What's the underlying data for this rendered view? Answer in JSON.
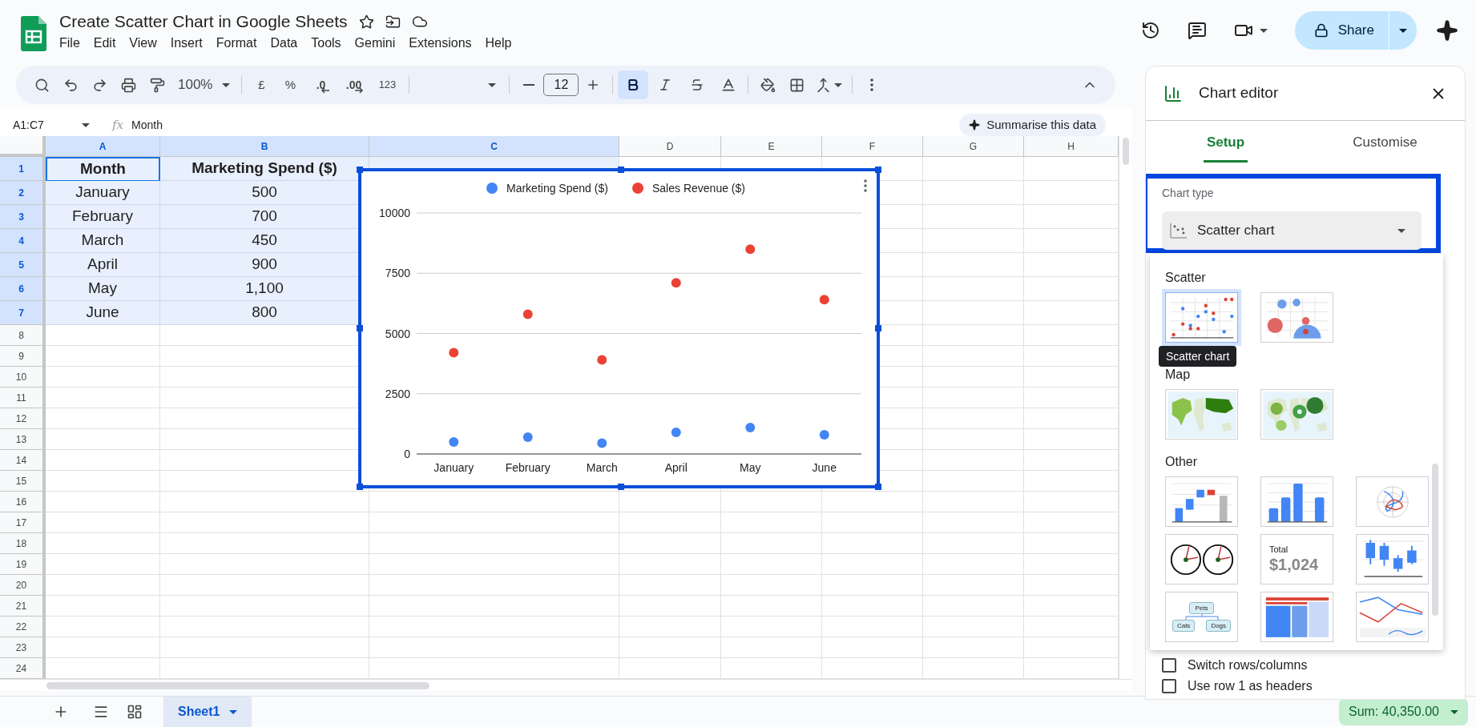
{
  "document": {
    "title": "Create Scatter Chart in Google Sheets"
  },
  "menu": [
    "File",
    "Edit",
    "View",
    "Insert",
    "Format",
    "Data",
    "Tools",
    "Gemini",
    "Extensions",
    "Help"
  ],
  "share": {
    "label": "Share"
  },
  "toolbar": {
    "zoom": "100%",
    "currency": "£",
    "percent": "%",
    "decrease_decimal": ".0",
    "increase_decimal": ".00",
    "number_format": "123",
    "font_size": "12",
    "format_buttons": [
      {
        "kind": "bold",
        "selected": true
      },
      {
        "kind": "italic",
        "selected": false
      },
      {
        "kind": "strikethrough",
        "selected": false
      }
    ]
  },
  "formula_bar": {
    "name_box": "A1:C7",
    "fx": "fx",
    "formula": "Month",
    "summarise": "Summarise this data"
  },
  "sheet": {
    "columns": [
      {
        "label": "A",
        "selected": true
      },
      {
        "label": "B",
        "selected": true
      },
      {
        "label": "C",
        "selected": true
      },
      {
        "label": "D",
        "selected": false
      },
      {
        "label": "E",
        "selected": false
      },
      {
        "label": "F",
        "selected": false
      },
      {
        "label": "G",
        "selected": false
      },
      {
        "label": "H",
        "selected": false
      }
    ],
    "rows": [
      {
        "number": "1",
        "selected": true,
        "kind": "header",
        "cells": [
          {
            "text": "Month",
            "active": true
          },
          {
            "text": "Marketing Spend ($)",
            "active": false
          }
        ]
      },
      {
        "number": "2",
        "selected": true,
        "kind": "data",
        "cells": [
          {
            "text": "January",
            "active": false
          },
          {
            "text": "500",
            "active": false
          }
        ]
      },
      {
        "number": "3",
        "selected": true,
        "kind": "data",
        "cells": [
          {
            "text": "February",
            "active": false
          },
          {
            "text": "700",
            "active": false
          }
        ]
      },
      {
        "number": "4",
        "selected": true,
        "kind": "data",
        "cells": [
          {
            "text": "March",
            "active": false
          },
          {
            "text": "450",
            "active": false
          }
        ]
      },
      {
        "number": "5",
        "selected": true,
        "kind": "data",
        "cells": [
          {
            "text": "April",
            "active": false
          },
          {
            "text": "900",
            "active": false
          }
        ]
      },
      {
        "number": "6",
        "selected": true,
        "kind": "data",
        "cells": [
          {
            "text": "May",
            "active": false
          },
          {
            "text": "1,100",
            "active": false
          }
        ]
      },
      {
        "number": "7",
        "selected": true,
        "kind": "data",
        "cells": [
          {
            "text": "June",
            "active": false
          },
          {
            "text": "800",
            "active": false
          }
        ]
      },
      {
        "number": "8",
        "selected": false
      },
      {
        "number": "9",
        "selected": false
      },
      {
        "number": "10",
        "selected": false
      },
      {
        "number": "11",
        "selected": false
      },
      {
        "number": "12",
        "selected": false
      },
      {
        "number": "13",
        "selected": false
      },
      {
        "number": "14",
        "selected": false
      },
      {
        "number": "15",
        "selected": false
      },
      {
        "number": "16",
        "selected": false
      },
      {
        "number": "17",
        "selected": false
      },
      {
        "number": "18",
        "selected": false
      },
      {
        "number": "19",
        "selected": false
      },
      {
        "number": "20",
        "selected": false
      },
      {
        "number": "21",
        "selected": false
      },
      {
        "number": "22",
        "selected": false
      },
      {
        "number": "23",
        "selected": false
      },
      {
        "number": "24",
        "selected": false
      }
    ]
  },
  "chart": {
    "chart_data": {
      "type": "scatter",
      "categories": [
        "January",
        "February",
        "March",
        "April",
        "May",
        "June"
      ],
      "series": [
        {
          "name": "Marketing Spend ($)",
          "color": "#4285f4",
          "values": [
            500,
            700,
            450,
            900,
            1100,
            800
          ]
        },
        {
          "name": "Sales Revenue ($)",
          "color": "#ea4335",
          "values": [
            4200,
            5800,
            3900,
            7100,
            8500,
            6400
          ]
        }
      ],
      "ylim": [
        0,
        10000
      ],
      "yticks": [
        0,
        2500,
        5000,
        7500,
        10000
      ],
      "grid": true,
      "legend": "top"
    }
  },
  "chart_editor": {
    "title": "Chart editor",
    "tabs": [
      {
        "label": "Setup",
        "selected": true
      },
      {
        "label": "Customise",
        "selected": false
      }
    ],
    "chart_type_label": "Chart type",
    "chart_type": "Scatter chart",
    "picker": {
      "groups": [
        {
          "label": "Scatter",
          "items": [
            {
              "kind": "scatter",
              "selected": true
            },
            {
              "kind": "bubble",
              "selected": false
            }
          ]
        },
        {
          "label": "Map",
          "items": [
            {
              "kind": "geo",
              "selected": false
            },
            {
              "kind": "geo_bubble",
              "selected": false
            }
          ]
        },
        {
          "label": "Other",
          "items": [
            {
              "kind": "waterfall",
              "selected": false
            },
            {
              "kind": "column",
              "selected": false
            },
            {
              "kind": "radar",
              "selected": false
            },
            {
              "kind": "gauge",
              "selected": false
            },
            {
              "kind": "scorecard",
              "selected": false,
              "label": "Total",
              "value": "$1,024"
            },
            {
              "kind": "candlestick",
              "selected": false
            },
            {
              "kind": "org",
              "selected": false,
              "nodes": [
                "Pets",
                "Cats",
                "Dogs"
              ]
            },
            {
              "kind": "treemap",
              "selected": false
            },
            {
              "kind": "timeline",
              "selected": false
            }
          ]
        }
      ]
    },
    "tooltip": "Scatter chart",
    "options": [
      {
        "label": "Switch rows/columns",
        "checked": false
      },
      {
        "label": "Use row 1 as headers",
        "checked": false
      }
    ]
  },
  "sheet_tabs": [
    {
      "label": "Sheet1",
      "selected": true
    }
  ],
  "status": {
    "sum": "Sum: 40,350.00"
  }
}
